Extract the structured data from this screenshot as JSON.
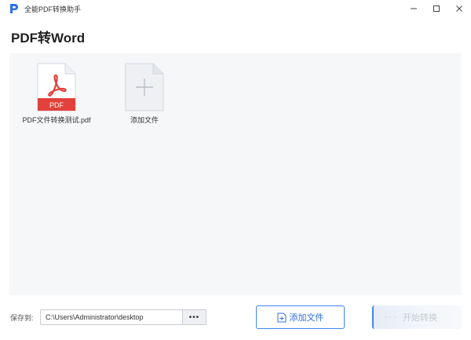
{
  "window": {
    "title": "全能PDF转换助手",
    "controls": [
      "minimize-icon",
      "maximize-icon",
      "close-icon"
    ]
  },
  "page": {
    "title": "PDF转Word"
  },
  "files": [
    {
      "name": "PDF文件转换测试.pdf",
      "badge": "PDF",
      "icon": "pdf-file-icon"
    }
  ],
  "add_card": {
    "label": "添加文件",
    "icon": "plus-file-icon"
  },
  "footer": {
    "save_label": "保存到:",
    "path_value": "C:\\Users\\Administrator\\desktop",
    "browse_label": "•••",
    "add_button_label": "添加文件",
    "convert_button_label": "开始转换",
    "convert_button_dots": "···"
  },
  "colors": {
    "accent": "#3f86f2",
    "pdf_badge": "#e2413c",
    "workspace_bg": "#f6f7f9"
  }
}
